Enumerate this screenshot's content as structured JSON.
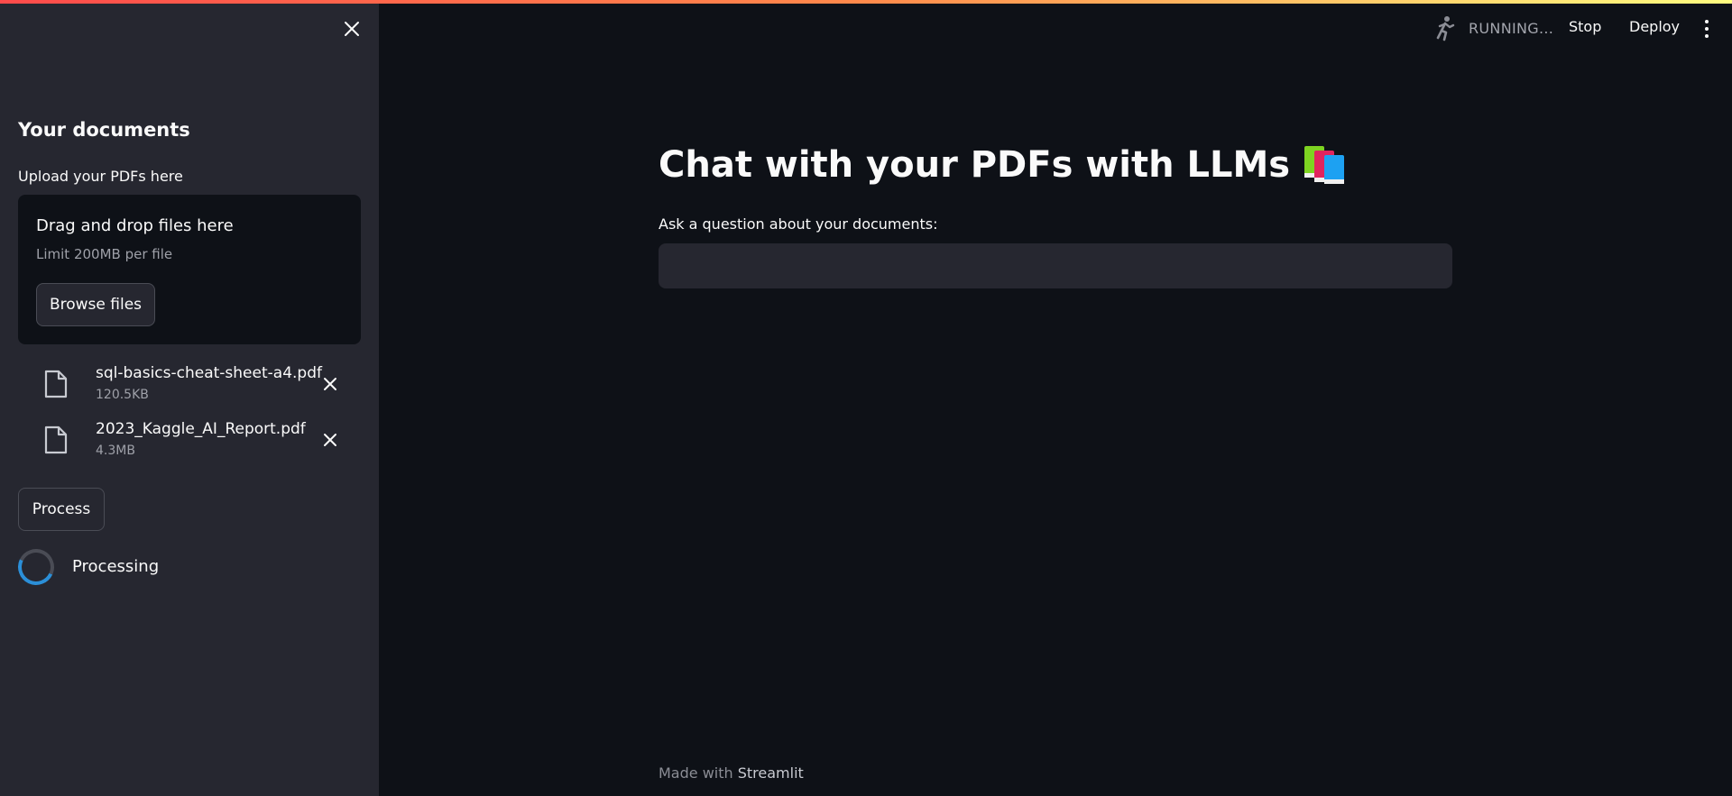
{
  "sidebar": {
    "heading": "Your documents",
    "upload_label": "Upload your PDFs here",
    "dropzone": {
      "title": "Drag and drop files here",
      "limit": "Limit 200MB per file",
      "browse_label": "Browse files"
    },
    "files": [
      {
        "name": "sql-basics-cheat-sheet-a4.pdf",
        "size": "120.5KB"
      },
      {
        "name": "2023_Kaggle_AI_Report.pdf",
        "size": "4.3MB"
      }
    ],
    "process_label": "Process",
    "processing_label": "Processing"
  },
  "header": {
    "status": "RUNNING...",
    "stop_label": "Stop",
    "deploy_label": "Deploy"
  },
  "main": {
    "title": "Chat with your PDFs with LLMs",
    "question_label": "Ask a question about your documents:",
    "question_value": ""
  },
  "footer": {
    "prefix": "Made with",
    "brand": "Streamlit"
  },
  "colors": {
    "background": "#0e1117",
    "sidebar": "#262730",
    "text": "#fafafa",
    "muted": "#9ea0a8",
    "spinner_accent": "#2b8fd8"
  },
  "icons": [
    "close-icon",
    "file-icon",
    "remove-file-icon",
    "running-man-icon",
    "more-vertical-icon",
    "books-icon"
  ]
}
